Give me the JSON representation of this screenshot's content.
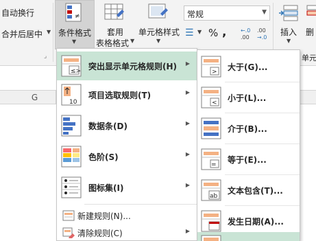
{
  "ribbon": {
    "alignment": {
      "wrap_text": "自动换行",
      "merge_center": "合并后居中"
    },
    "styles": {
      "conditional_format": "条件格式",
      "format_as_table_l1": "套用",
      "format_as_table_l2": "表格格式",
      "cell_styles": "单元格样式"
    },
    "number": {
      "format_value": "常规",
      "percent": "%",
      "comma": ","
    },
    "cells": {
      "insert": "插入",
      "delete_partial": "删"
    },
    "edge_label": "单元"
  },
  "sheet": {
    "column_g": "G"
  },
  "menu": {
    "items": [
      {
        "label": "突出显示单元格规则(H)",
        "active": true
      },
      {
        "label": "项目选取规则(T)",
        "active": false
      },
      {
        "label": "数据条(D)",
        "active": false
      },
      {
        "label": "色阶(S)",
        "active": false
      },
      {
        "label": "图标集(I)",
        "active": false
      }
    ],
    "small_items": [
      {
        "label": "新建规则(N)..."
      },
      {
        "label": "清除规则(C)"
      }
    ]
  },
  "submenu": {
    "items": [
      {
        "label": "大于(G)..."
      },
      {
        "label": "小于(L)..."
      },
      {
        "label": "介于(B)..."
      },
      {
        "label": "等于(E)..."
      },
      {
        "label": "文本包含(T)..."
      },
      {
        "label": "发生日期(A)..."
      }
    ]
  },
  "colors": {
    "highlight": "#c9e4d5",
    "ribbon_bg": "#f3f3f3",
    "orange_bar": "#f4b183",
    "blue_bar": "#4472c4"
  }
}
